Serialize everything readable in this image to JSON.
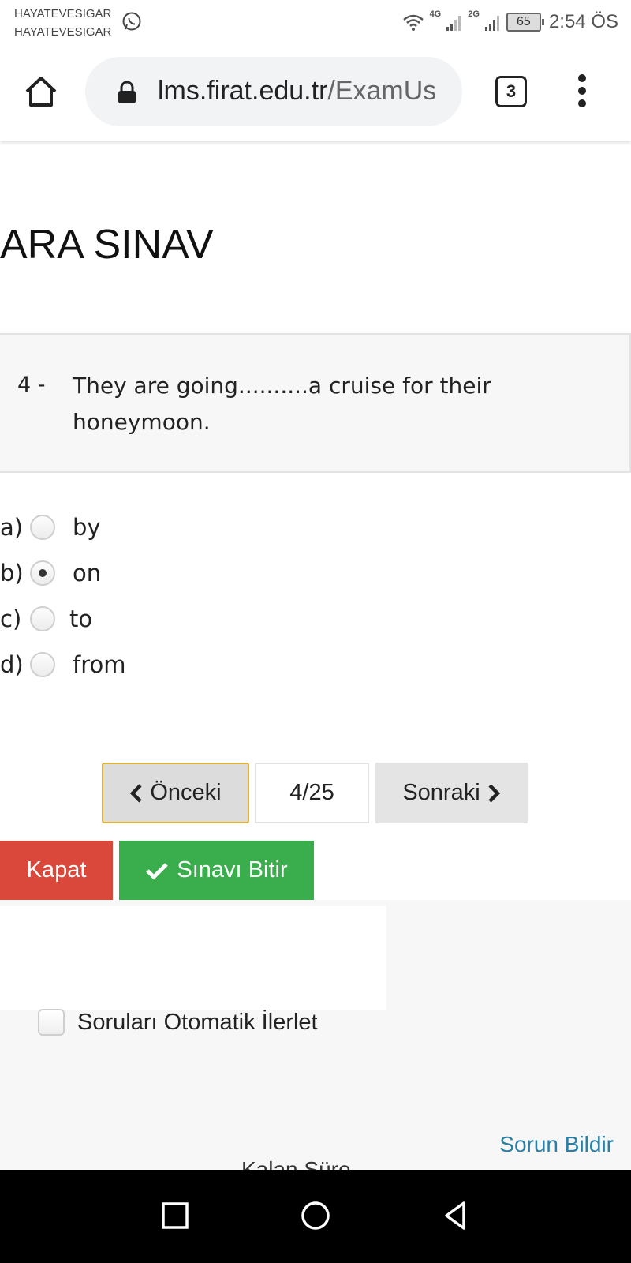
{
  "status_bar": {
    "notification_line_1": "HAYATEVESIGAR",
    "notification_line_2": "HAYATEVESIGAR",
    "network_1": "4G",
    "network_2": "2G",
    "battery": "65",
    "time": "2:54 ÖS"
  },
  "browser": {
    "url_domain": "lms.firat.edu.tr",
    "url_path": "/ExamUs",
    "tab_count": "3"
  },
  "exam": {
    "title": "ARA SINAV",
    "question_number": "4 -",
    "question_text": "They are going..........a cruise for their honeymoon.",
    "options": [
      {
        "letter": "a)",
        "text": "by",
        "selected": false
      },
      {
        "letter": "b)",
        "text": "on",
        "selected": true
      },
      {
        "letter": "c)",
        "text": "to",
        "selected": false
      },
      {
        "letter": "d)",
        "text": "from",
        "selected": false
      }
    ],
    "pager": {
      "prev_label": "Önceki",
      "position": "4/25",
      "next_label": "Sonraki"
    },
    "close_label": "Kapat",
    "finish_label": "Sınavı Bitir",
    "auto_advance_label": "Soruları Otomatik İlerlet",
    "report_label": "Sorun Bildir",
    "cut_off_text": "Kalan Süre"
  },
  "colors": {
    "close_button": "#d9483b",
    "finish_button": "#3aae4c",
    "link": "#2a7fa6",
    "prev_border": "#e0b23a"
  }
}
